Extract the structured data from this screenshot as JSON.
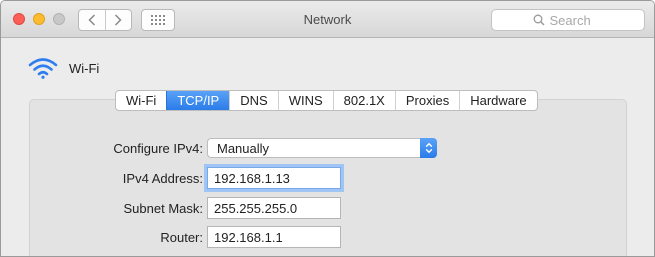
{
  "window": {
    "title": "Network"
  },
  "toolbar": {
    "back_icon": "chevron-left-icon",
    "forward_icon": "chevron-right-icon",
    "grid_icon": "grid-icon",
    "search_placeholder": "Search"
  },
  "interface": {
    "icon": "wifi-icon",
    "name": "Wi-Fi"
  },
  "tabs": [
    {
      "label": "Wi-Fi",
      "active": false
    },
    {
      "label": "TCP/IP",
      "active": true
    },
    {
      "label": "DNS",
      "active": false
    },
    {
      "label": "WINS",
      "active": false
    },
    {
      "label": "802.1X",
      "active": false
    },
    {
      "label": "Proxies",
      "active": false
    },
    {
      "label": "Hardware",
      "active": false
    }
  ],
  "form": {
    "configure_ipv4": {
      "label": "Configure IPv4:",
      "value": "Manually"
    },
    "ipv4_address": {
      "label": "IPv4 Address:",
      "value": "192.168.1.13"
    },
    "subnet_mask": {
      "label": "Subnet Mask:",
      "value": "255.255.255.0"
    },
    "router": {
      "label": "Router:",
      "value": "192.168.1.1"
    }
  },
  "colors": {
    "accent": "#2b7ce9",
    "wifi_icon": "#2f7ef0",
    "close": "#fc5f57",
    "minimize": "#fdbc2e",
    "maximize_inactive": "#c8c8c8"
  }
}
